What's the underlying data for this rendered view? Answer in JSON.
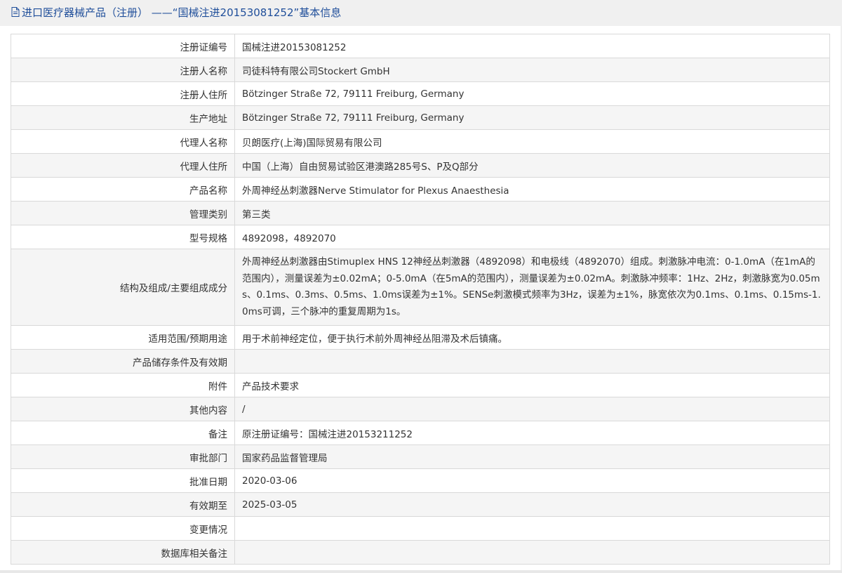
{
  "header": {
    "title": "进口医疗器械产品（注册） ——“国械注进20153081252”基本信息"
  },
  "rows": [
    {
      "label": "注册证编号",
      "value": "国械注进20153081252"
    },
    {
      "label": "注册人名称",
      "value": "司徒科特有限公司Stockert GmbH"
    },
    {
      "label": "注册人住所",
      "value": "Bötzinger Straße 72, 79111 Freiburg, Germany"
    },
    {
      "label": "生产地址",
      "value": "Bötzinger Straße 72, 79111 Freiburg, Germany"
    },
    {
      "label": "代理人名称",
      "value": "贝朗医疗(上海)国际贸易有限公司"
    },
    {
      "label": "代理人住所",
      "value": "中国（上海）自由贸易试验区港澳路285号S、P及Q部分"
    },
    {
      "label": "产品名称",
      "value": "外周神经丛刺激器Nerve Stimulator for Plexus Anaesthesia"
    },
    {
      "label": "管理类别",
      "value": "第三类"
    },
    {
      "label": "型号规格",
      "value": "4892098，4892070"
    },
    {
      "label": "结构及组成/主要组成成分",
      "value": "外周神经丛刺激器由Stimuplex HNS 12神经丛刺激器（4892098）和电极线（4892070）组成。刺激脉冲电流：0-1.0mA（在1mA的范围内），测量误差为±0.02mA；0-5.0mA（在5mA的范围内），测量误差为±0.02mA。刺激脉冲频率：1Hz、2Hz，刺激脉宽为0.05ms、0.1ms、0.3ms、0.5ms、1.0ms误差为±1%。SENSe刺激模式频率为3Hz，误差为±1%，脉宽依次为0.1ms、0.1ms、0.15ms-1.0ms可调，三个脉冲的重复周期为1s。"
    },
    {
      "label": "适用范围/预期用途",
      "value": "用于术前神经定位，便于执行术前外周神经丛阻滞及术后镇痛。"
    },
    {
      "label": "产品储存条件及有效期",
      "value": ""
    },
    {
      "label": "附件",
      "value": "产品技术要求"
    },
    {
      "label": "其他内容",
      "value": "/"
    },
    {
      "label": "备注",
      "value": "原注册证编号：国械注进20153211252"
    },
    {
      "label": "审批部门",
      "value": "国家药品监督管理局"
    },
    {
      "label": "批准日期",
      "value": "2020-03-06"
    },
    {
      "label": "有效期至",
      "value": "2025-03-05"
    },
    {
      "label": "变更情况",
      "value": ""
    },
    {
      "label": "数据库相关备注",
      "value": ""
    }
  ],
  "colors": {
    "header_text": "#1f4e9a",
    "alt_row_bg": "#f5f5f5",
    "border": "#d9d9d9"
  },
  "icons": {
    "header": "document-icon"
  }
}
